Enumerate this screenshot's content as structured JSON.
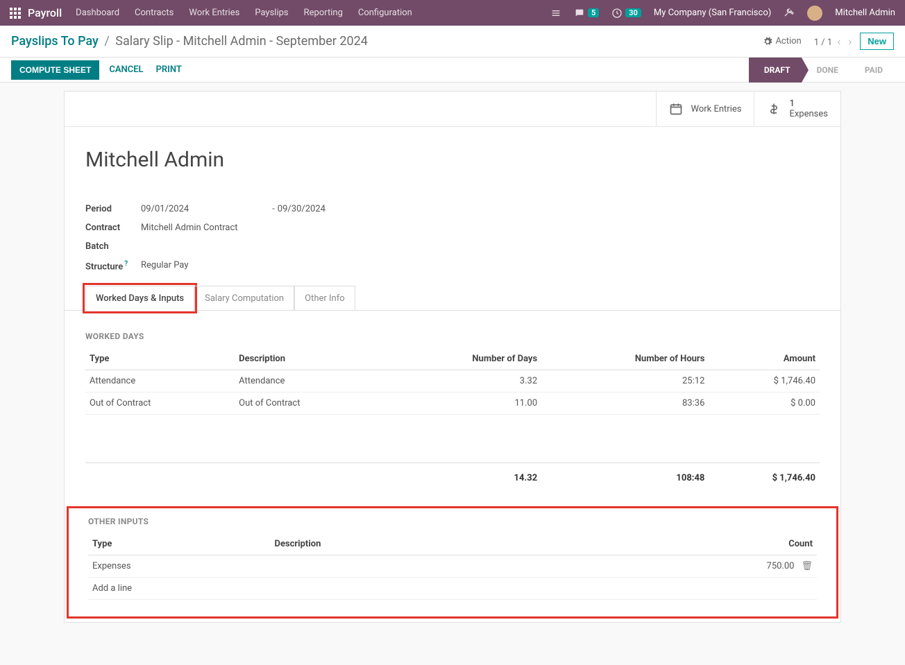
{
  "brand": "Payroll",
  "menu": [
    "Dashboard",
    "Contracts",
    "Work Entries",
    "Payslips",
    "Reporting",
    "Configuration"
  ],
  "topright": {
    "chat_badge": "5",
    "clock_badge": "30",
    "company": "My Company (San Francisco)",
    "user": "Mitchell Admin"
  },
  "crumbs": {
    "root": "Payslips To Pay",
    "current": "Salary Slip - Mitchell Admin - September 2024"
  },
  "action_label": "Action",
  "pager": "1 / 1",
  "new_label": "New",
  "buttons": {
    "compute": "COMPUTE SHEET",
    "cancel": "CANCEL",
    "print": "PRINT"
  },
  "status": {
    "draft": "DRAFT",
    "done": "DONE",
    "paid": "PAID"
  },
  "stats": {
    "work_entries": "Work Entries",
    "expenses_count": "1",
    "expenses_label": "Expenses"
  },
  "title": "Mitchell Admin",
  "fields": {
    "period_label": "Period",
    "period_from": "09/01/2024",
    "period_to": "09/30/2024",
    "contract_label": "Contract",
    "contract_value": "Mitchell Admin Contract",
    "batch_label": "Batch",
    "structure_label": "Structure",
    "structure_value": "Regular Pay"
  },
  "tabs": [
    "Worked Days & Inputs",
    "Salary Computation",
    "Other Info"
  ],
  "worked_days": {
    "title": "WORKED DAYS",
    "cols": [
      "Type",
      "Description",
      "Number of Days",
      "Number of Hours",
      "Amount"
    ],
    "rows": [
      {
        "type": "Attendance",
        "desc": "Attendance",
        "days": "3.32",
        "hours": "25:12",
        "amount": "$ 1,746.40"
      },
      {
        "type": "Out of Contract",
        "desc": "Out of Contract",
        "days": "11.00",
        "hours": "83:36",
        "amount": "$ 0.00"
      }
    ],
    "totals": {
      "days": "14.32",
      "hours": "108:48",
      "amount": "$ 1,746.40"
    }
  },
  "other_inputs": {
    "title": "OTHER INPUTS",
    "cols": [
      "Type",
      "Description",
      "Count"
    ],
    "rows": [
      {
        "type": "Expenses",
        "desc": "",
        "count": "750.00"
      }
    ],
    "addline": "Add a line"
  }
}
